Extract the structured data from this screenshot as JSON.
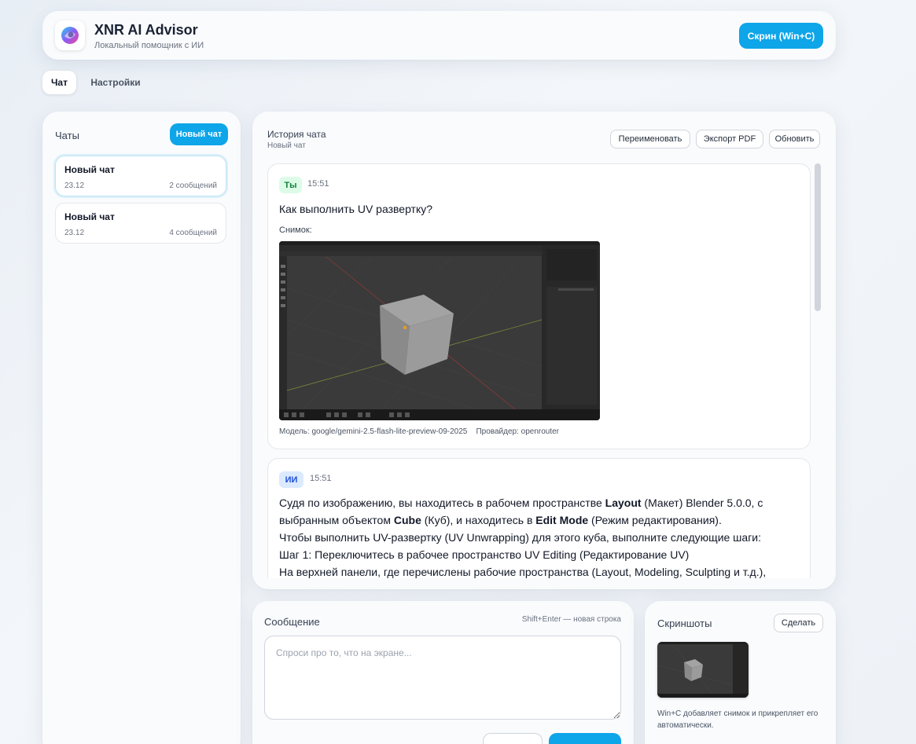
{
  "app": {
    "title": "XNR AI Advisor",
    "subtitle": "Локальный помощник с ИИ",
    "screen_button": "Скрин (Win+C)"
  },
  "tabs": [
    {
      "label": "Чат",
      "active": true
    },
    {
      "label": "Настройки",
      "active": false
    }
  ],
  "sidebar": {
    "title": "Чаты",
    "new_chat_button": "Новый чат",
    "chats": [
      {
        "title": "Новый чат",
        "date": "23.12",
        "count": "2 сообщений",
        "active": true
      },
      {
        "title": "Новый чат",
        "date": "23.12",
        "count": "4 сообщений",
        "active": false
      }
    ]
  },
  "history": {
    "title": "История чата",
    "subtitle": "Новый чат",
    "rename_button": "Переименовать",
    "export_button": "Экспорт PDF",
    "refresh_button": "Обновить",
    "messages": [
      {
        "author": "Ты",
        "time": "15:51",
        "text": "Как выполнить UV развертку?",
        "snapshot_label": "Снимок:",
        "model": "Модель: google/gemini-2.5-flash-lite-preview-09-2025",
        "provider": "Провайдер: openrouter"
      },
      {
        "author": "ИИ",
        "time": "15:51",
        "lines": [
          {
            "parts": [
              "Судя по изображению, вы находитесь в рабочем пространстве ",
              "Layout",
              " (Макет) Blender 5.0.0, с"
            ]
          },
          {
            "parts": [
              "выбранным объектом ",
              "Cube",
              " (Куб), и находитесь в ",
              "Edit Mode",
              " (Режим редактирования)."
            ]
          },
          {
            "text": "Чтобы выполнить UV-развертку (UV Unwrapping) для этого куба, выполните следующие шаги:"
          },
          {
            "text": "Шаг 1: Переключитесь в рабочее пространство UV Editing (Редактирование UV)"
          },
          {
            "text": "На верхней панели, где перечислены рабочие пространства (Layout, Modeling, Sculpting и т.д.),"
          }
        ]
      }
    ]
  },
  "composer": {
    "title": "Сообщение",
    "hint": "Shift+Enter — новая строка",
    "placeholder": "Спроси про то, что на экране..."
  },
  "screenshots": {
    "title": "Скриншоты",
    "make_button": "Сделать",
    "note": "Win+C добавляет снимок и прикрепляет его автоматически."
  },
  "colors": {
    "accent": "#0ea5e9",
    "user_badge_bg": "#dcfce7",
    "ai_badge_bg": "#dbeafe"
  }
}
